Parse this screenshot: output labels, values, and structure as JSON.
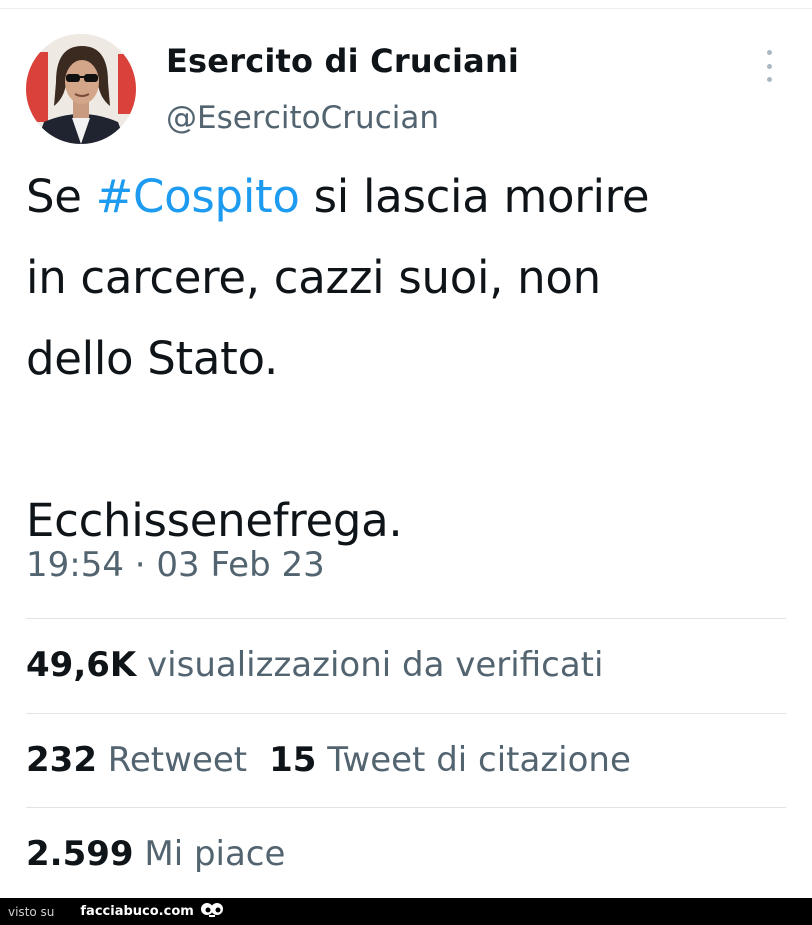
{
  "author": {
    "name": "Esercito di Cruciani",
    "handle": "@EsercitoCrucian"
  },
  "tweet": {
    "line1_before": "Se ",
    "hashtag": "#Cospito",
    "line1_after": " si lascia morire",
    "line2": "in carcere, cazzi suoi, non",
    "line3": "dello Stato.",
    "line4": "Ecchissenefrega.",
    "timestamp": "19:54 · 03 Feb 23"
  },
  "stats": {
    "views_count": "49,6K",
    "views_label": "visualizzazioni da verificati",
    "retweets_count": "232",
    "retweets_label": "Retweet",
    "quotes_count": "15",
    "quotes_label": "Tweet di citazione",
    "likes_count": "2.599",
    "likes_label": "Mi piace"
  },
  "footer": {
    "prefix": "visto su",
    "site": "facciabuco.com"
  },
  "colors": {
    "hashtag": "#1d9bf0",
    "secondary_text": "#536471",
    "primary_text": "#0f1419"
  },
  "icons": {
    "more": "more-vertical-icon",
    "footer_logo": "googly-eyes-icon"
  }
}
